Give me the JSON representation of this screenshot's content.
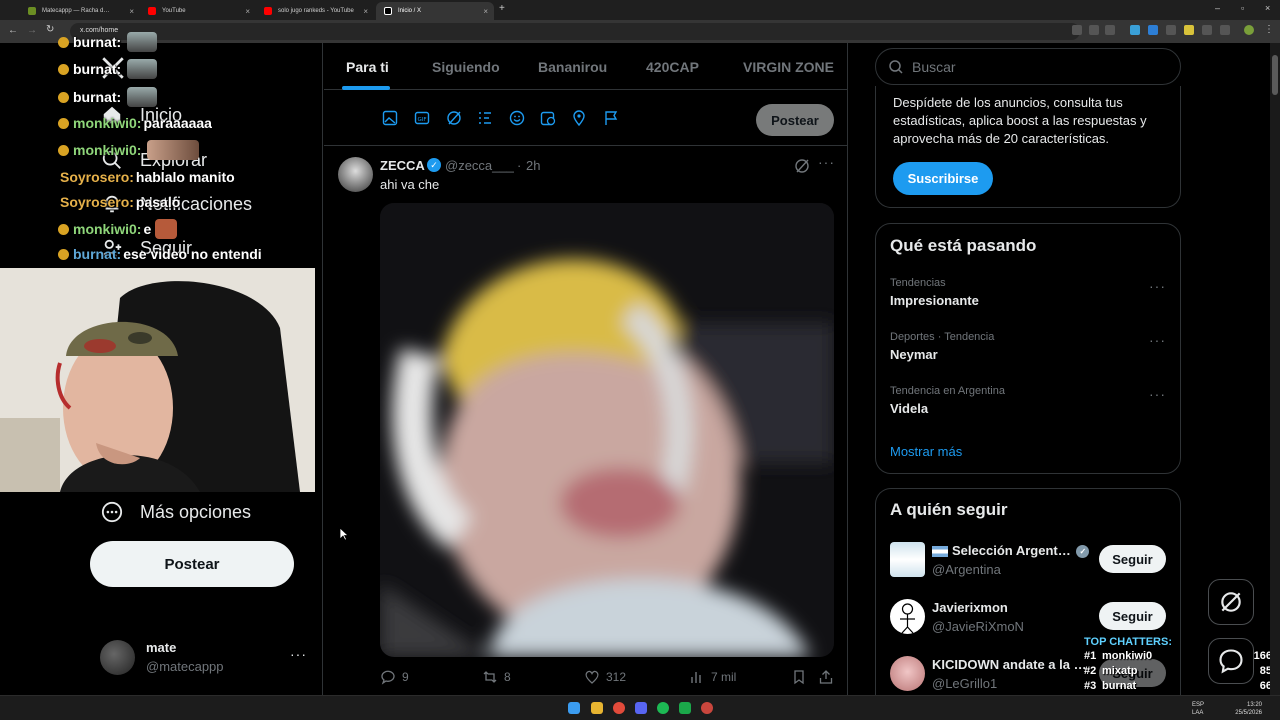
{
  "browser": {
    "tabs": [
      {
        "label": "Matecappp — Racha d…",
        "active": false
      },
      {
        "label": "YouTube",
        "active": false
      },
      {
        "label": "solo jugo rankeds - YouTube",
        "active": false
      },
      {
        "label": "Inicio / X",
        "active": true
      }
    ],
    "url": "x.com/home",
    "new_tab_label": "+"
  },
  "chat": [
    {
      "user": "burnat:",
      "msg": "",
      "user_color": "#ffffff"
    },
    {
      "user": "burnat:",
      "msg": "",
      "user_color": "#ffffff"
    },
    {
      "user": "burnat:",
      "msg": "",
      "user_color": "#ffffff"
    },
    {
      "user": "monkiwi0:",
      "msg": "paraaaaaa",
      "user_color": "#8fd67a"
    },
    {
      "user": "monkiwi0:",
      "msg": "",
      "user_color": "#8fd67a"
    },
    {
      "user": "Soyrosero:",
      "msg": "hablalo manito",
      "user_color": "#e6b14a"
    },
    {
      "user": "Soyrosero:",
      "msg": "pasalo",
      "user_color": "#e6b14a"
    },
    {
      "user": "monkiwi0:",
      "msg": "e",
      "user_color": "#8fd67a"
    },
    {
      "user": "burnat:",
      "msg": "ese video no entendi",
      "user_color": "#ffffff"
    }
  ],
  "leftnav": {
    "items": [
      {
        "label": "Inicio",
        "icon": "home-icon"
      },
      {
        "label": "Explorar",
        "icon": "search-icon"
      },
      {
        "label": "Notificaciones",
        "icon": "bell-icon"
      },
      {
        "label": "Seguir",
        "icon": "person-add-icon"
      }
    ],
    "more_label": "Más opciones",
    "post_label": "Postear",
    "account": {
      "name": "mate",
      "handle": "@matecappp"
    }
  },
  "feed": {
    "tabs": [
      "Para ti",
      "Siguiendo",
      "Bananirou",
      "420CAP",
      "VIRGIN ZONE"
    ],
    "active_tab": "Para ti",
    "composer_post_label": "Postear",
    "tweet": {
      "author": "ZECCA",
      "handle": "@zecca___",
      "time": "2h",
      "text": "ahi va che",
      "replies": "9",
      "reposts": "8",
      "likes": "312",
      "views": "7 mil"
    }
  },
  "right": {
    "search_placeholder": "Buscar",
    "premium": {
      "text": "Despídete de los anuncios, consulta tus estadísticas, aplica boost a las respuestas y aprovecha más de 20 características.",
      "button": "Suscribirse"
    },
    "trends": {
      "title": "Qué está pasando",
      "items": [
        {
          "context": "Tendencias",
          "name": "Impresionante"
        },
        {
          "context": "Deportes · Tendencia",
          "name": "Neymar"
        },
        {
          "context": "Tendencia en Argentina",
          "name": "Videla"
        }
      ],
      "show_more": "Mostrar más"
    },
    "who_to_follow": {
      "title": "A quién seguir",
      "users": [
        {
          "name": "Selección Argent…",
          "handle": "@Argentina",
          "button": "Seguir"
        },
        {
          "name": "Javierixmon",
          "handle": "@JavieRiXmoN",
          "button": "Seguir"
        },
        {
          "name": "KICIDOWN andate a la …",
          "handle": "@LeGrillo1",
          "button": "Seguir"
        }
      ]
    }
  },
  "top_chatters": {
    "title": "TOP CHATTERS:",
    "rows": [
      {
        "rank": "#1",
        "name": "monkiwi0",
        "count": "166"
      },
      {
        "rank": "#2",
        "name": "mixatp",
        "count": "85"
      },
      {
        "rank": "#3",
        "name": "burnat",
        "count": "66"
      }
    ]
  },
  "taskbar": {
    "lang": "ESP\nLAA",
    "time": "13:20",
    "date": "25/5/2026"
  },
  "colors": {
    "accent": "#1d9bf0",
    "background": "#000000",
    "border": "#2f3336"
  }
}
